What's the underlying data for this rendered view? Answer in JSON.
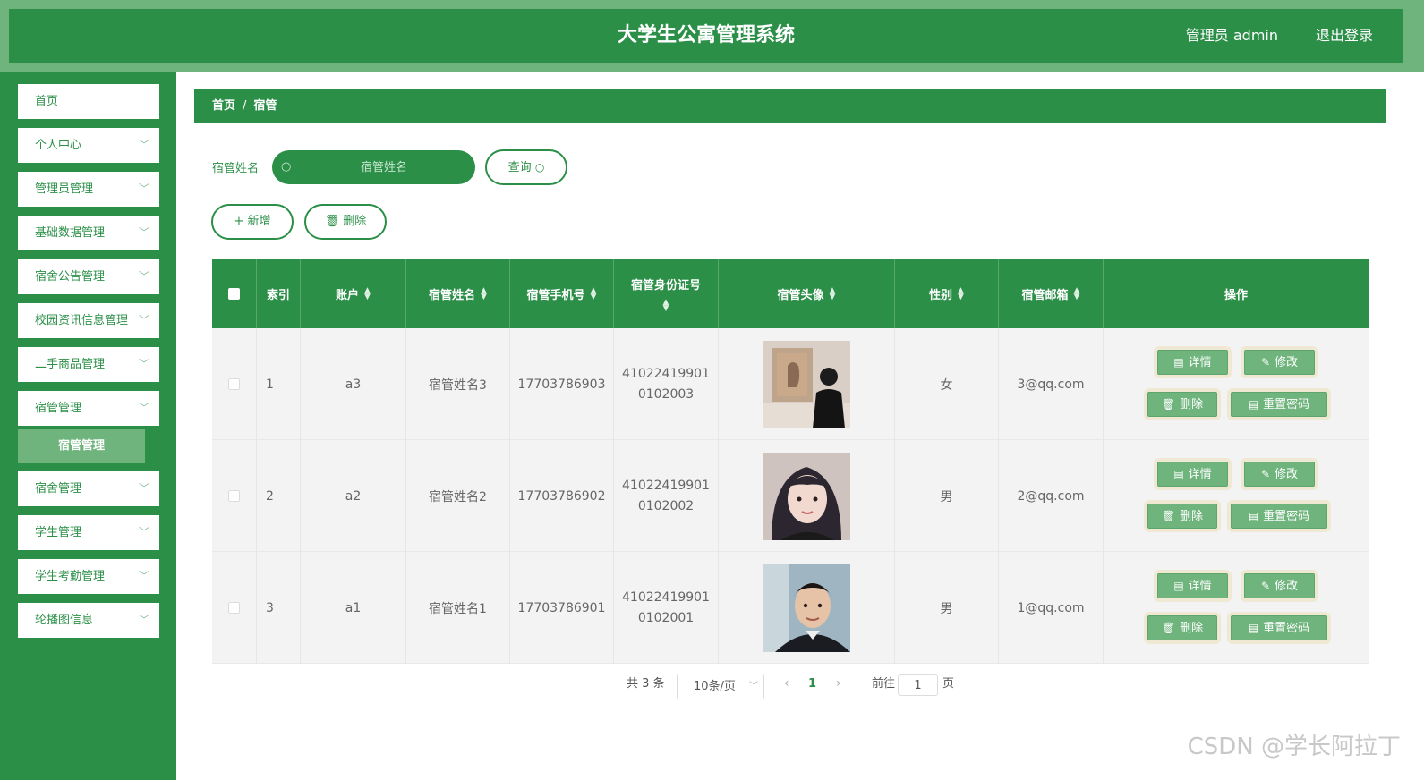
{
  "header": {
    "title": "大学生公寓管理系统",
    "user": "管理员 admin",
    "logout": "退出登录"
  },
  "sidebar": {
    "items": [
      {
        "label": "首页",
        "has_arrow": false
      },
      {
        "label": "个人中心",
        "has_arrow": true
      },
      {
        "label": "管理员管理",
        "has_arrow": true
      },
      {
        "label": "基础数据管理",
        "has_arrow": true
      },
      {
        "label": "宿舍公告管理",
        "has_arrow": true
      },
      {
        "label": "校园资讯信息管理",
        "has_arrow": true
      },
      {
        "label": "二手商品管理",
        "has_arrow": true
      },
      {
        "label": "宿管管理",
        "has_arrow": true
      },
      {
        "label": "宿舍管理",
        "has_arrow": true
      },
      {
        "label": "学生管理",
        "has_arrow": true
      },
      {
        "label": "学生考勤管理",
        "has_arrow": true
      },
      {
        "label": "轮播图信息",
        "has_arrow": true
      }
    ],
    "active_sub": "宿管管理"
  },
  "breadcrumb": {
    "home": "首页",
    "current": "宿管"
  },
  "search": {
    "label": "宿管姓名",
    "placeholder": "宿管姓名",
    "button": "查询"
  },
  "toolbar": {
    "add": "新增",
    "delete": "删除"
  },
  "table": {
    "headers": {
      "index": "索引",
      "account": "账户",
      "name": "宿管姓名",
      "phone": "宿管手机号",
      "idcard": "宿管身份证号",
      "avatar": "宿管头像",
      "gender": "性别",
      "email": "宿管邮箱",
      "actions": "操作"
    },
    "rows": [
      {
        "index": "1",
        "account": "a3",
        "name": "宿管姓名3",
        "phone": "17703786903",
        "idcard_line1": "41022419901",
        "idcard_line2": "0102003",
        "gender": "女",
        "email": "3@qq.com",
        "avatar_style": "gallery"
      },
      {
        "index": "2",
        "account": "a2",
        "name": "宿管姓名2",
        "phone": "17703786902",
        "idcard_line1": "41022419901",
        "idcard_line2": "0102002",
        "gender": "男",
        "email": "2@qq.com",
        "avatar_style": "girl"
      },
      {
        "index": "3",
        "account": "a1",
        "name": "宿管姓名1",
        "phone": "17703786901",
        "idcard_line1": "41022419901",
        "idcard_line2": "0102001",
        "gender": "男",
        "email": "1@qq.com",
        "avatar_style": "boy"
      }
    ],
    "actions": {
      "detail": "详情",
      "edit": "修改",
      "delete": "删除",
      "reset": "重置密码"
    }
  },
  "pagination": {
    "total": "共 3 条",
    "page_size": "10条/页",
    "current": "1",
    "goto_label": "前往",
    "goto_value": "1",
    "page_unit": "页"
  },
  "watermark": "CSDN @学长阿拉丁",
  "colors": {
    "primary": "#2b8f48",
    "light": "#6fb47d",
    "action_bg": "#efe9d3"
  }
}
